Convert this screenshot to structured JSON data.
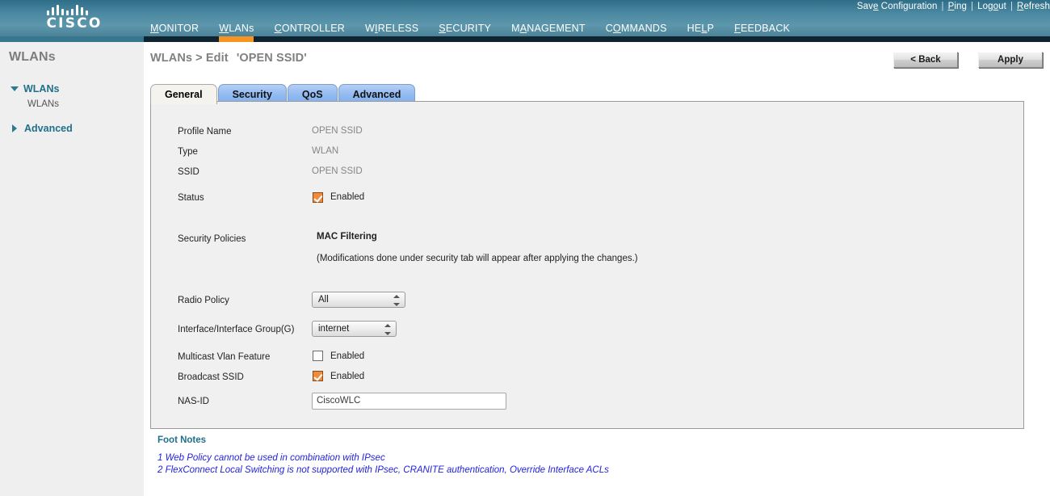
{
  "header": {
    "logo": {
      "wordmark": "CISCO",
      "bars": [
        6,
        10,
        13,
        8,
        6,
        8,
        13,
        10,
        6
      ]
    },
    "util_links": [
      {
        "text": "Save Configuration",
        "mnemonic_index": 3
      },
      {
        "text": "Ping",
        "mnemonic_index": 0
      },
      {
        "text": "Logout",
        "mnemonic_index": 3
      },
      {
        "text": "Refresh",
        "mnemonic_index": 0
      }
    ],
    "nav": [
      {
        "label": "MONITOR",
        "mnemonic_index": 0,
        "active": false
      },
      {
        "label": "WLANs",
        "mnemonic_index": 0,
        "active": true
      },
      {
        "label": "CONTROLLER",
        "mnemonic_index": 0,
        "active": false
      },
      {
        "label": "WIRELESS",
        "mnemonic_index": 1,
        "active": false
      },
      {
        "label": "SECURITY",
        "mnemonic_index": 0,
        "active": false
      },
      {
        "label": "MANAGEMENT",
        "mnemonic_index": 1,
        "active": false
      },
      {
        "label": "COMMANDS",
        "mnemonic_index": 1,
        "active": false
      },
      {
        "label": "HELP",
        "mnemonic_index": 2,
        "active": false
      },
      {
        "label": "FEEDBACK",
        "mnemonic_index": 0,
        "active": false
      }
    ]
  },
  "sidebar": {
    "title": "WLANs",
    "tree": [
      {
        "label": "WLANs",
        "expanded": true
      },
      {
        "label": "WLANs",
        "child": true
      },
      {
        "label": "Advanced",
        "expanded": false
      }
    ]
  },
  "page": {
    "breadcrumb": "WLANs > Edit",
    "breadcrumb_target": "'OPEN SSID'",
    "back_label": "< Back",
    "apply_label": "Apply"
  },
  "tabs": [
    {
      "label": "General",
      "active": true
    },
    {
      "label": "Security",
      "active": false
    },
    {
      "label": "QoS",
      "active": false
    },
    {
      "label": "Advanced",
      "active": false
    }
  ],
  "form": {
    "profile_name_label": "Profile Name",
    "profile_name_value": "OPEN SSID",
    "type_label": "Type",
    "type_value": "WLAN",
    "ssid_label": "SSID",
    "ssid_value": "OPEN SSID",
    "status_label": "Status",
    "status_checkbox_label": "Enabled",
    "status_checked": true,
    "security_policies_label": "Security Policies",
    "security_policies_value": "MAC Filtering",
    "security_policies_note": "(Modifications done under security tab will appear after applying the changes.)",
    "radio_policy_label": "Radio Policy",
    "radio_policy_value": "All",
    "interface_label": "Interface/Interface Group(G)",
    "interface_value": "internet",
    "multicast_label": "Multicast Vlan Feature",
    "multicast_checkbox_label": "Enabled",
    "multicast_checked": false,
    "broadcast_label": "Broadcast SSID",
    "broadcast_checkbox_label": "Enabled",
    "broadcast_checked": true,
    "nas_id_label": "NAS-ID",
    "nas_id_value": "CiscoWLC"
  },
  "footnotes": {
    "title": "Foot Notes",
    "items": [
      "1 Web Policy cannot be used in combination with IPsec",
      "2 FlexConnect Local Switching is not supported with IPsec, CRANITE authentication, Override Interface ACLs"
    ]
  },
  "colors": {
    "header_blue": "#4a87a0",
    "nav_strip": "#0e2431",
    "accent_orange": "#f79321",
    "checkbox_orange": "#ef8b3f",
    "teal_link": "#1f6f8b",
    "footnote_blue": "#2222dd"
  }
}
